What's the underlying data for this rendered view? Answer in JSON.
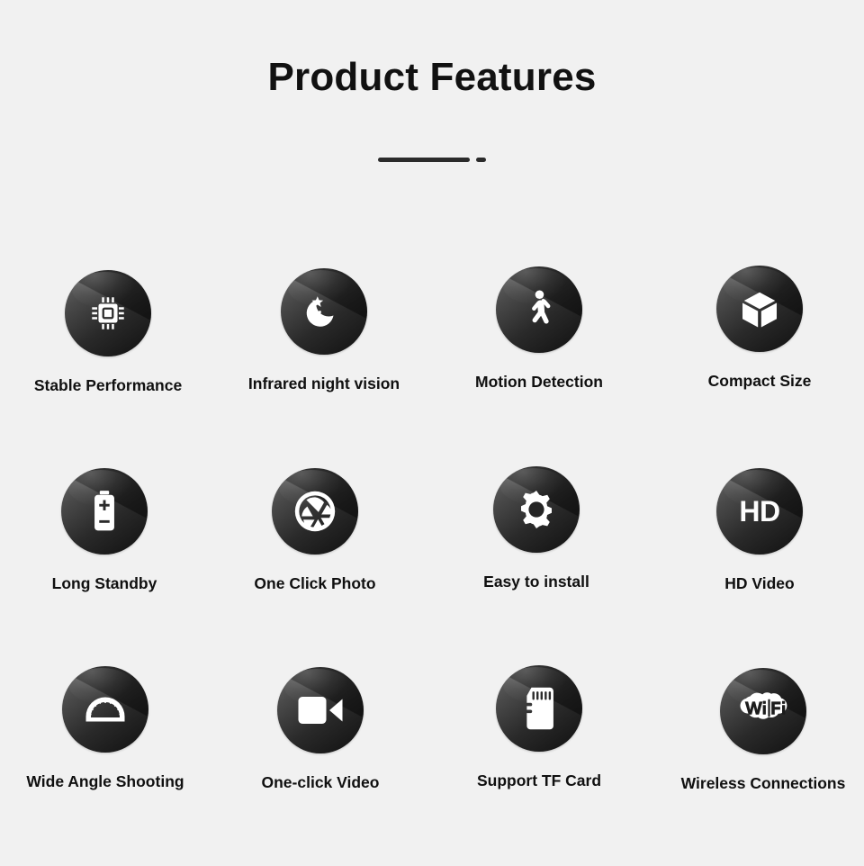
{
  "page": {
    "background_color": "#f1f1f1",
    "title": "Product Features",
    "divider": {
      "long_dash": "",
      "short_dash": "",
      "color": "#2b2b2b"
    }
  },
  "theme": {
    "icon_circle_light": "#6e6e6e",
    "icon_circle_dark": "#101010",
    "icon_color": "#ffffff",
    "label_color": "#101010"
  },
  "features": {
    "rows": [
      {
        "items": [
          {
            "label": "Stable Performance",
            "icon": "cpu-chip-icon"
          },
          {
            "label": "Infrared night vision",
            "icon": "moon-stars-icon"
          },
          {
            "label": "Motion Detection",
            "icon": "walking-person-icon"
          },
          {
            "label": "Compact Size",
            "icon": "cube-icon"
          }
        ]
      },
      {
        "items": [
          {
            "label": "Long Standby",
            "icon": "battery-icon"
          },
          {
            "label": "One Click Photo",
            "icon": "camera-aperture-icon"
          },
          {
            "label": "Easy to install",
            "icon": "gear-icon"
          },
          {
            "label": "HD Video",
            "icon": "hd-text-icon",
            "icon_text": "HD"
          }
        ]
      },
      {
        "items": [
          {
            "label": "Wide Angle Shooting",
            "icon": "protractor-icon"
          },
          {
            "label": "One-click Video",
            "icon": "video-camera-icon"
          },
          {
            "label": "Support TF Card",
            "icon": "microsd-card-icon"
          },
          {
            "label": "Wireless Connections",
            "icon": "wifi-logo-icon",
            "icon_text": "WiFi"
          }
        ]
      }
    ]
  }
}
